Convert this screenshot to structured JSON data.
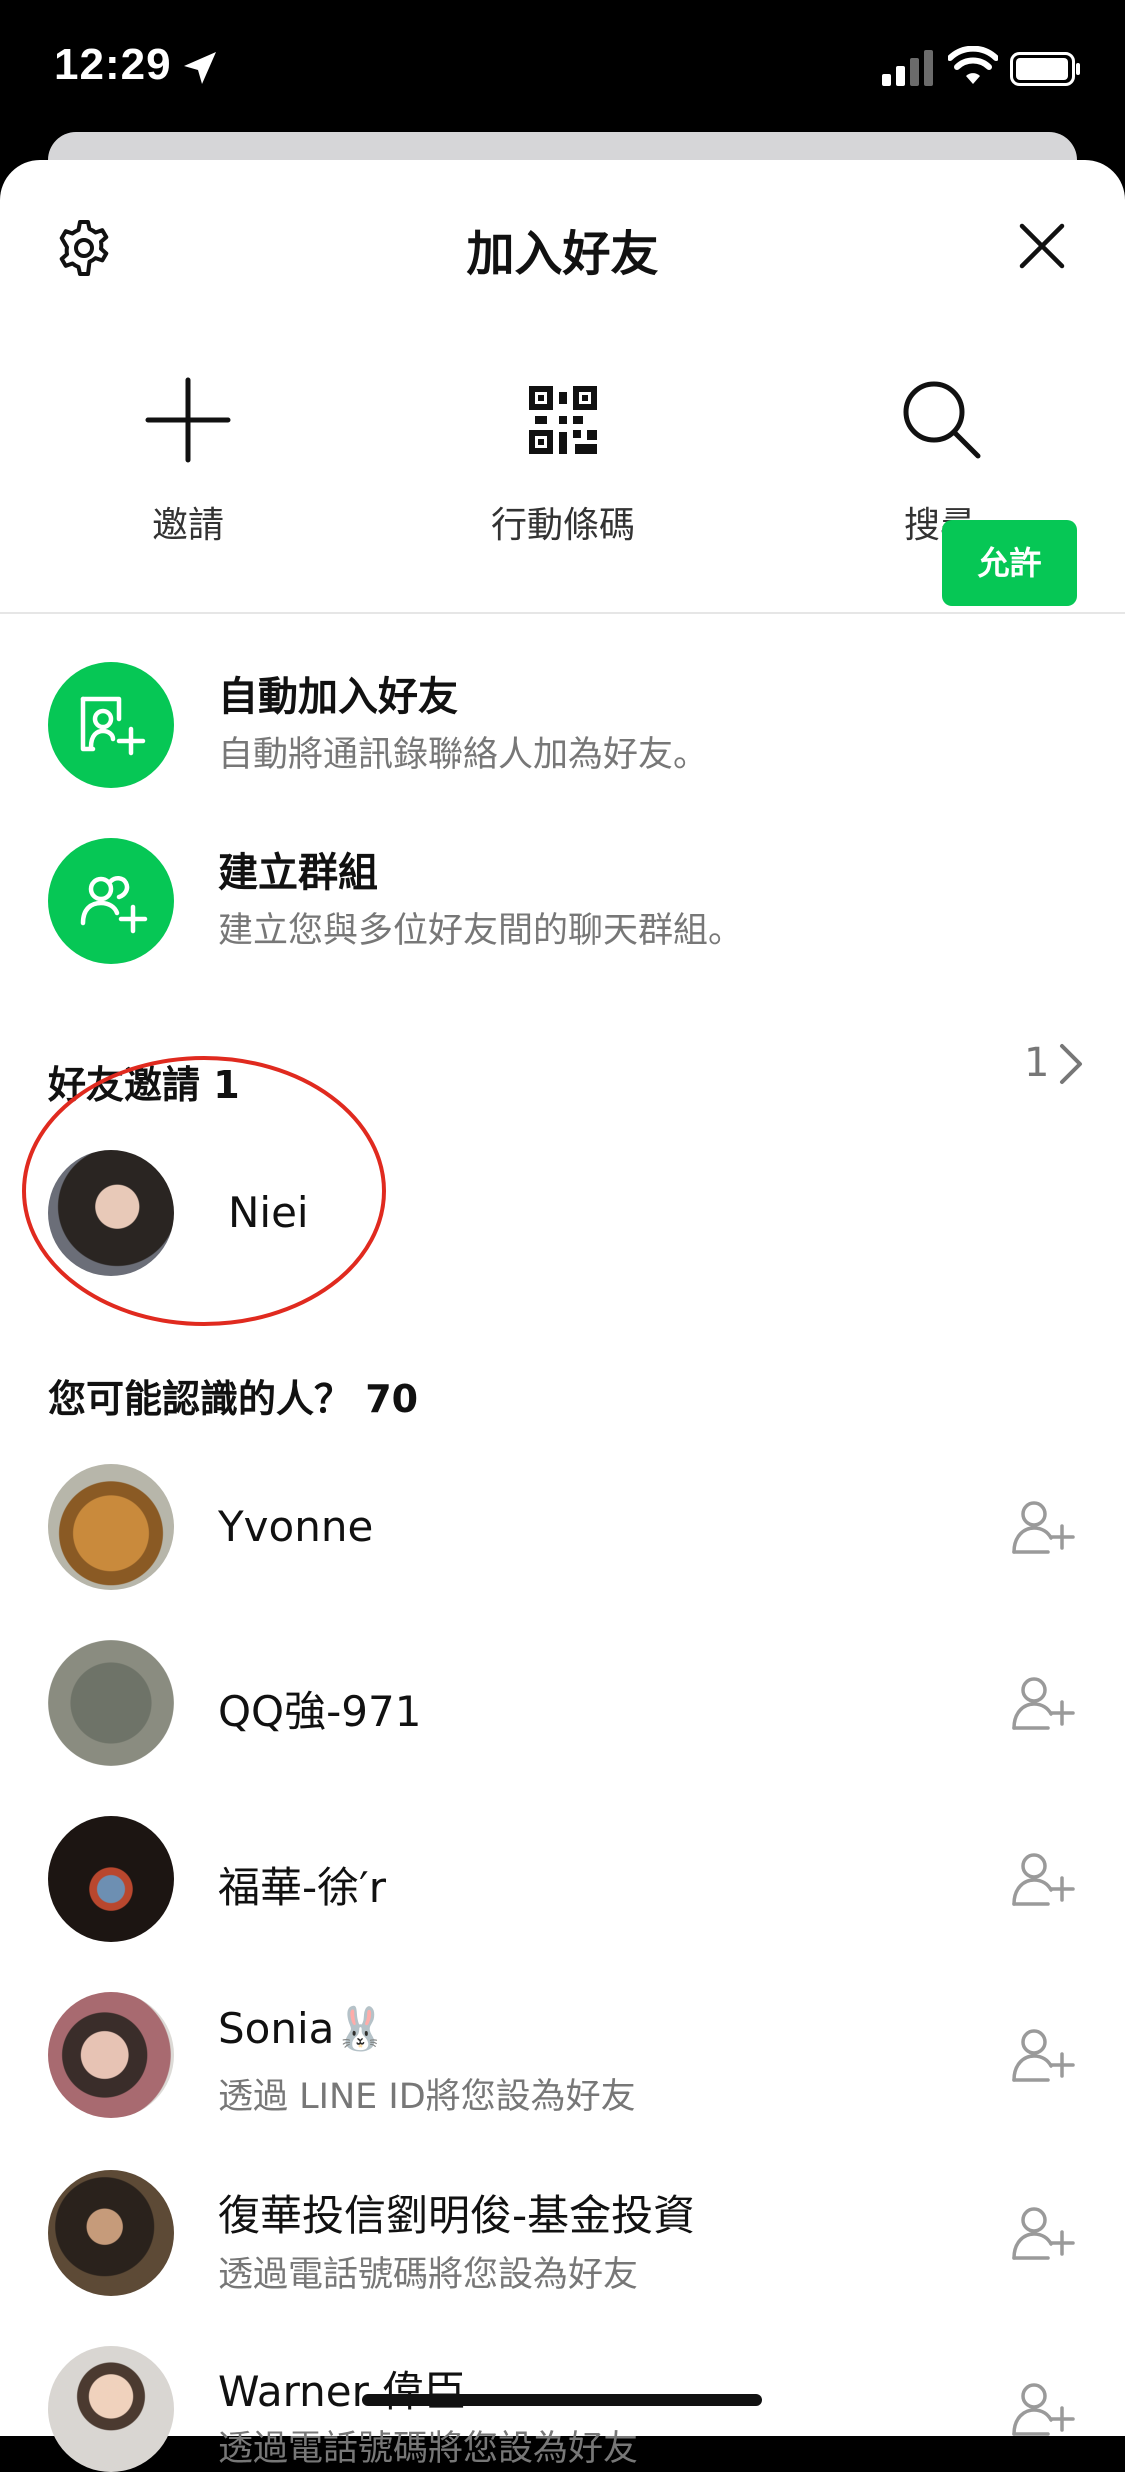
{
  "status_bar": {
    "time": "12:29"
  },
  "header": {
    "title": "加入好友"
  },
  "actions": [
    {
      "label": "邀請",
      "icon": "plus-icon"
    },
    {
      "label": "行動條碼",
      "icon": "qr-code-icon"
    },
    {
      "label": "搜尋",
      "icon": "search-icon"
    }
  ],
  "auto_add": {
    "title": "自動加入好友",
    "subtitle": "自動將通訊錄聯絡人加為好友。",
    "button": "允許"
  },
  "create_group": {
    "title": "建立群組",
    "subtitle": "建立您與多位好友間的聊天群組。"
  },
  "friend_requests": {
    "heading": "好友邀請 1",
    "items": [
      {
        "name": "Niei",
        "count": "1"
      }
    ]
  },
  "suggestions": {
    "heading": "您可能認識的人？ 70",
    "items": [
      {
        "name": "Yvonne",
        "subtitle": ""
      },
      {
        "name": "QQ強-971",
        "subtitle": ""
      },
      {
        "name": "福華-徐′r",
        "subtitle": ""
      },
      {
        "name": "Sonia🐰",
        "subtitle": "透過 LINE ID將您設為好友"
      },
      {
        "name": "復華投信劉明俊-基金投資",
        "subtitle": "透過電話號碼將您設為好友"
      },
      {
        "name": "Warner 偉臣",
        "subtitle": "透過電話號碼將您設為好友"
      }
    ]
  },
  "colors": {
    "accent": "#06c755",
    "highlight": "#e02a1f"
  }
}
